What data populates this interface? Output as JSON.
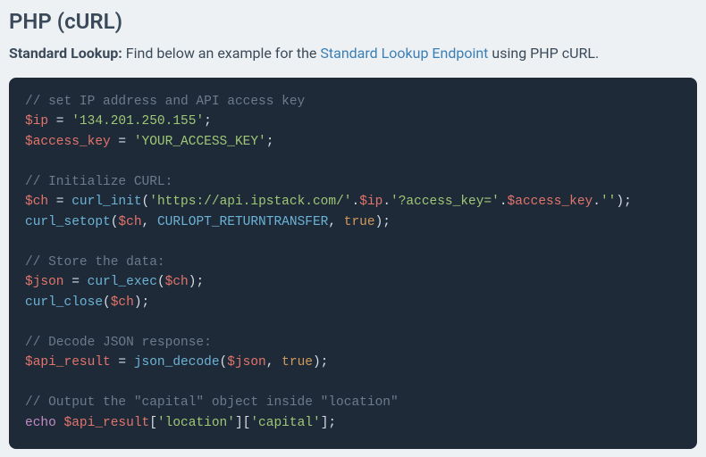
{
  "heading": "PHP (cURL)",
  "intro": {
    "bold": "Standard Lookup:",
    "before_link": " Find below an example for the ",
    "link_text": "Standard Lookup Endpoint",
    "after_link": " using PHP cURL."
  },
  "code": {
    "l1_comment": "// set IP address and API access key",
    "l2_var": "$ip",
    "l2_eq": " = ",
    "l2_str": "'134.201.250.155'",
    "l2_semi": ";",
    "l3_var": "$access_key",
    "l3_eq": " = ",
    "l3_str": "'YOUR_ACCESS_KEY'",
    "l3_semi": ";",
    "l5_comment": "// Initialize CURL:",
    "l6_var": "$ch",
    "l6_eq": " = ",
    "l6_fn": "curl_init",
    "l6_p1": "(",
    "l6_s1": "'https://api.ipstack.com/'",
    "l6_d1": ".",
    "l6_v1": "$ip",
    "l6_d2": ".",
    "l6_s2": "'?access_key='",
    "l6_d3": ".",
    "l6_v2": "$access_key",
    "l6_d4": ".",
    "l6_s3": "''",
    "l6_p2": ");",
    "l7_fn": "curl_setopt",
    "l7_p1": "(",
    "l7_v1": "$ch",
    "l7_c1": ", ",
    "l7_const": "CURLOPT_RETURNTRANSFER",
    "l7_c2": ", ",
    "l7_bool": "true",
    "l7_p2": ");",
    "l9_comment": "// Store the data:",
    "l10_var": "$json",
    "l10_eq": " = ",
    "l10_fn": "curl_exec",
    "l10_p1": "(",
    "l10_v1": "$ch",
    "l10_p2": ");",
    "l11_fn": "curl_close",
    "l11_p1": "(",
    "l11_v1": "$ch",
    "l11_p2": ");",
    "l13_comment": "// Decode JSON response:",
    "l14_var": "$api_result",
    "l14_eq": " = ",
    "l14_fn": "json_decode",
    "l14_p1": "(",
    "l14_v1": "$json",
    "l14_c1": ", ",
    "l14_bool": "true",
    "l14_p2": ");",
    "l16_comment": "// Output the \"capital\" object inside \"location\"",
    "l17_kw": "echo",
    "l17_sp": " ",
    "l17_var": "$api_result",
    "l17_b1": "[",
    "l17_s1": "'location'",
    "l17_b2": "][",
    "l17_s2": "'capital'",
    "l17_b3": "];"
  }
}
